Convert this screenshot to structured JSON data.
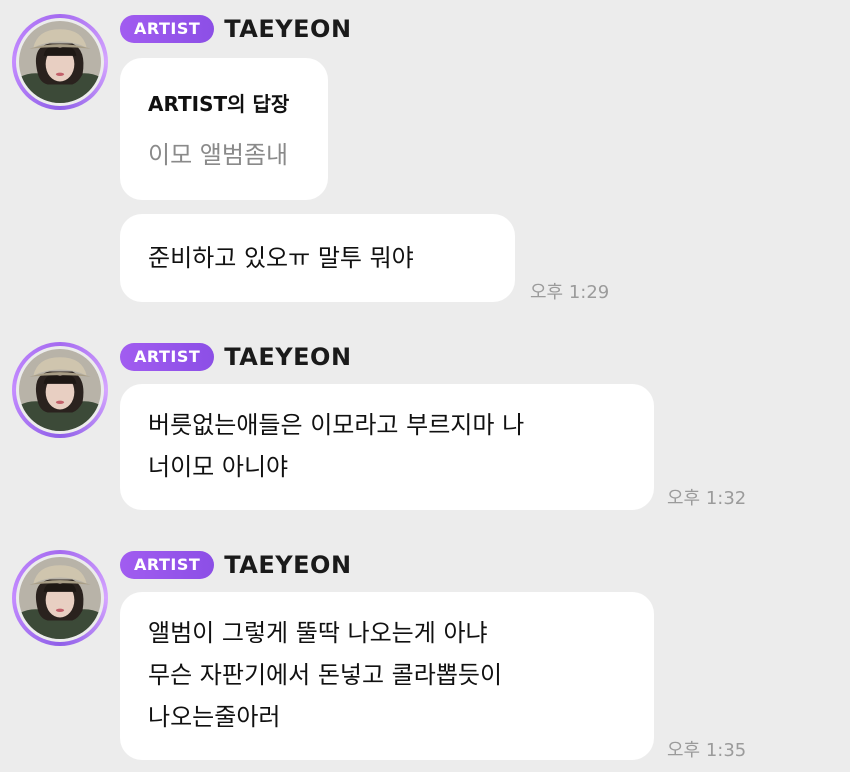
{
  "messages": [
    {
      "badge": "ARTIST",
      "sender": "TAEYEON",
      "reply": {
        "title": "ARTIST의 답장",
        "text": "이모 앨범좀내"
      },
      "lines": [
        "준비하고 있오ㅠ 말투 뭐야"
      ],
      "time": "오후 1:29"
    },
    {
      "badge": "ARTIST",
      "sender": "TAEYEON",
      "lines": [
        "버릇없는애들은 이모라고 부르지마 나",
        "너이모 아니야"
      ],
      "time": "오후 1:32"
    },
    {
      "badge": "ARTIST",
      "sender": "TAEYEON",
      "lines": [
        "앨범이 그렇게 뚤딱 나오는게 아냐",
        "무슨 자판기에서 돈넣고 콜라뽑듯이",
        "나오는줄아러"
      ],
      "time": "오후 1:35"
    }
  ]
}
